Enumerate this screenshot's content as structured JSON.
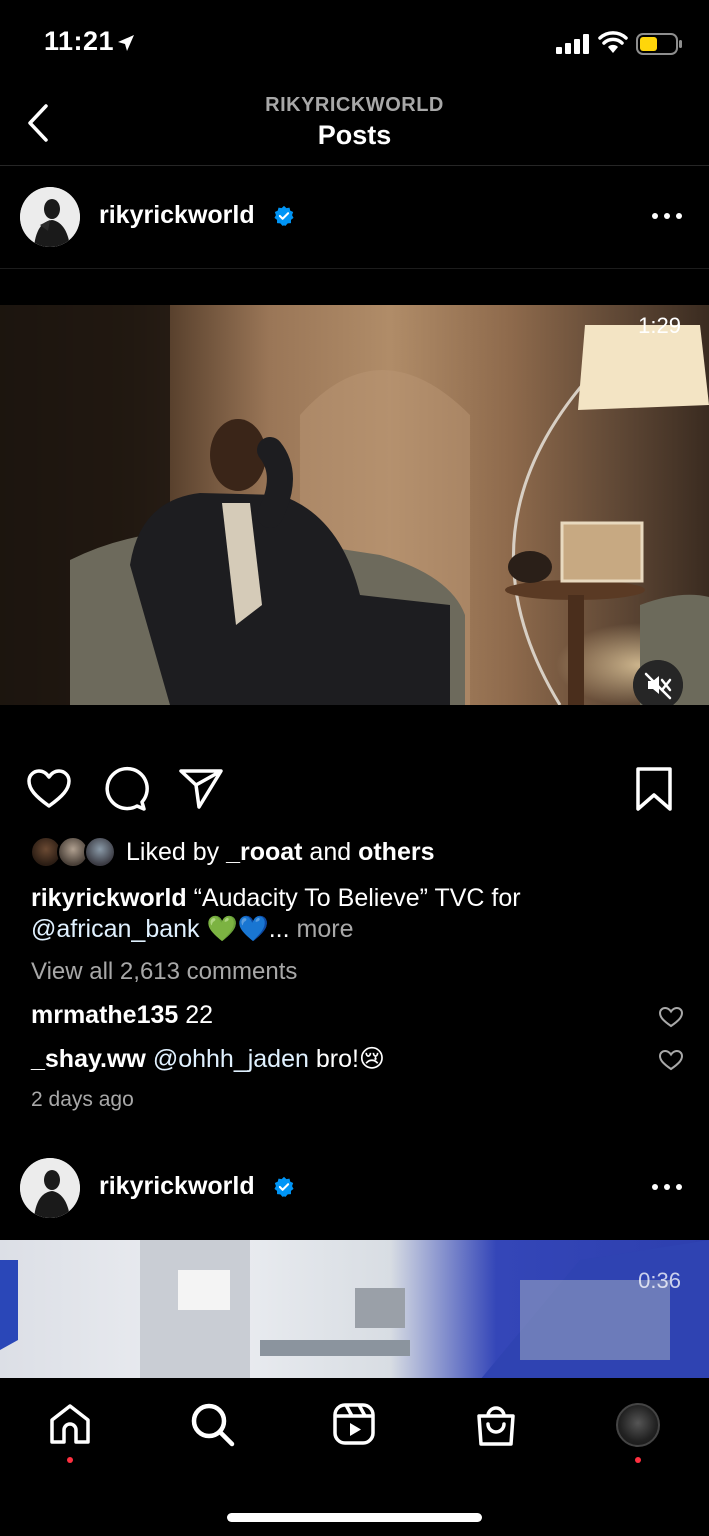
{
  "status_bar": {
    "time": "11:21"
  },
  "header": {
    "subtitle": "RIKYRICKWORLD",
    "title": "Posts"
  },
  "post1": {
    "username": "rikyrickworld",
    "duration": "1:29",
    "liked_prefix": "Liked by ",
    "liked_user": "_rooat",
    "liked_and": " and ",
    "liked_others": "others",
    "caption_user": "rikyrickworld",
    "caption_text": " “Audacity To Believe” TVC for",
    "caption_mention": "@african_bank",
    "caption_emoji": " 💚💙",
    "caption_more_dots": "... ",
    "caption_more": "more",
    "view_comments": "View all 2,613 comments",
    "comments": [
      {
        "user": "mrmathe135",
        "text": " 22"
      },
      {
        "user": "_shay.ww",
        "mention": " @ohhh_jaden",
        "text": " bro!😢"
      }
    ],
    "time_ago": "2 days ago"
  },
  "post2": {
    "username": "rikyrickworld",
    "duration": "0:36"
  },
  "colors": {
    "verified": "#0095f6",
    "notification_dot": "#ff3040",
    "muted_text": "#a8a8a8"
  },
  "icons": {
    "back": "chevron-left-icon",
    "more": "more-horizontal-icon",
    "like": "heart-icon",
    "comment": "comment-icon",
    "share": "paper-plane-icon",
    "save": "bookmark-icon",
    "mute": "speaker-muted-icon",
    "home": "home-icon",
    "search": "search-icon",
    "reels": "reels-icon",
    "shop": "shopping-bag-icon",
    "profile": "profile-avatar"
  }
}
